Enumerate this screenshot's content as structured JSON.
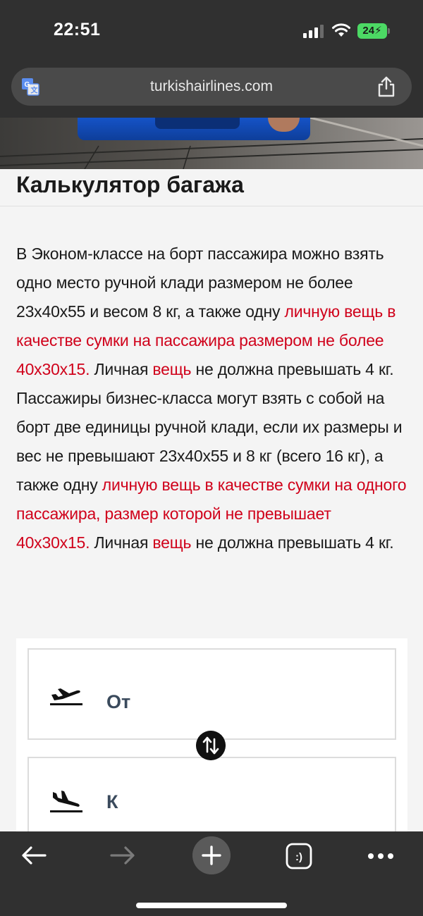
{
  "status_bar": {
    "time": "22:51",
    "battery": "24"
  },
  "browser": {
    "url": "turkishairlines.com"
  },
  "page": {
    "title": "Калькулятор багажа",
    "paragraph": [
      {
        "text": "В Эконом-классе на борт пассажира можно взять одно место ручной клади размером не более 23х40х55 и весом 8 кг, а также одну ",
        "highlight": false
      },
      {
        "text": "личную вещь в качестве сумки на пассажира размером не более 40х30х15.",
        "highlight": true
      },
      {
        "text": " Личная ",
        "highlight": false
      },
      {
        "text": "вещь",
        "highlight": true
      },
      {
        "text": " не должна превышать 4 кг. Пассажиры бизнес-класса могут взять с собой на борт две единицы ручной клади, если их размеры и вес не превышают 23х40х55 и 8 кг (всего 16 кг), а также одну ",
        "highlight": false
      },
      {
        "text": "личную вещь в качестве сумки на одного пассажира, размер которой не превышает 40х30х15.",
        "highlight": true
      },
      {
        "text": " Личная ",
        "highlight": false
      },
      {
        "text": "вещь",
        "highlight": true
      },
      {
        "text": " не должна превышать 4 кг.",
        "highlight": false
      }
    ]
  },
  "calculator": {
    "from_label": "От",
    "to_label": "К"
  },
  "colors": {
    "highlight": "#d0021b",
    "chrome": "#303030",
    "battery": "#4cd964"
  },
  "icons": {
    "translate": "translate-icon",
    "share": "share-icon",
    "departure": "plane-departure-icon",
    "arrival": "plane-arrival-icon",
    "swap": "swap-icon",
    "back": "arrow-left-icon",
    "forward": "arrow-right-icon",
    "new_tab": "plus-icon",
    "tabs": "tabs-icon",
    "more": "more-icon"
  },
  "toolbar": {
    "tabs_glyph": ":)"
  }
}
